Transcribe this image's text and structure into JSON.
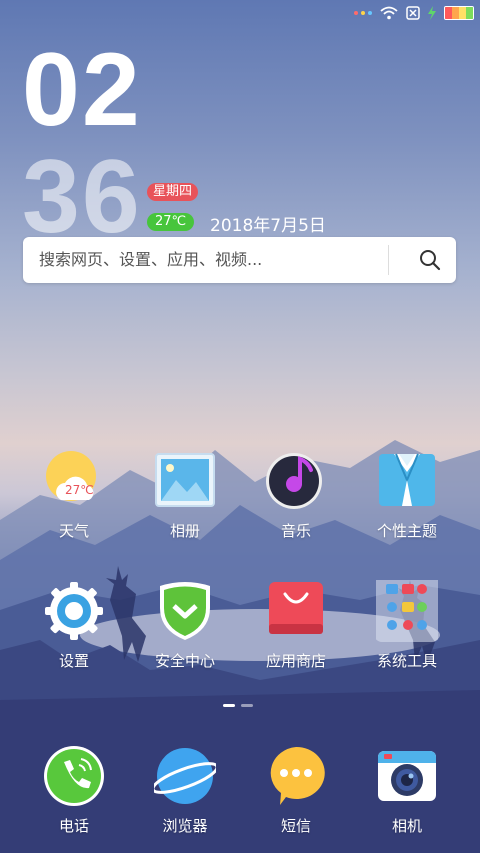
{
  "status_bar": {
    "icons": [
      "notification-dots-icon",
      "wifi-icon",
      "no-sim-icon",
      "charging-bolt-icon",
      "battery-icon"
    ],
    "notification_dot_colors": [
      "#ff6b6b",
      "#ffd54a",
      "#66c7ff"
    ],
    "battery_colors": [
      "#ff5a5a",
      "#ffa64d",
      "#ffe066",
      "#7ddc5b"
    ]
  },
  "clock": {
    "hour": "02",
    "minute": "36"
  },
  "weather_widget": {
    "weekday": "星期四",
    "temperature": "27℃",
    "date": "2018年7月5日"
  },
  "search": {
    "placeholder": "搜索网页、设置、应用、视频..."
  },
  "apps": [
    {
      "label": "天气",
      "icon": "weather-icon",
      "temp": "27℃"
    },
    {
      "label": "相册",
      "icon": "gallery-icon"
    },
    {
      "label": "音乐",
      "icon": "music-icon"
    },
    {
      "label": "个性主题",
      "icon": "themes-icon"
    },
    {
      "label": "设置",
      "icon": "settings-icon"
    },
    {
      "label": "安全中心",
      "icon": "security-icon"
    },
    {
      "label": "应用商店",
      "icon": "app-store-icon"
    },
    {
      "label": "系统工具",
      "icon": "folder-icon"
    }
  ],
  "page_indicator": {
    "pages": 2,
    "active": 1
  },
  "dock": [
    {
      "label": "电话",
      "icon": "phone-icon"
    },
    {
      "label": "浏览器",
      "icon": "browser-icon"
    },
    {
      "label": "短信",
      "icon": "messages-icon"
    },
    {
      "label": "相机",
      "icon": "camera-icon"
    }
  ],
  "colors": {
    "weekday_badge": "#e8535a",
    "temp_badge": "#47c53c",
    "phone": "#58c83c",
    "browser": "#3fa4ef",
    "messages": "#fcc23f",
    "store": "#ee4a58"
  }
}
